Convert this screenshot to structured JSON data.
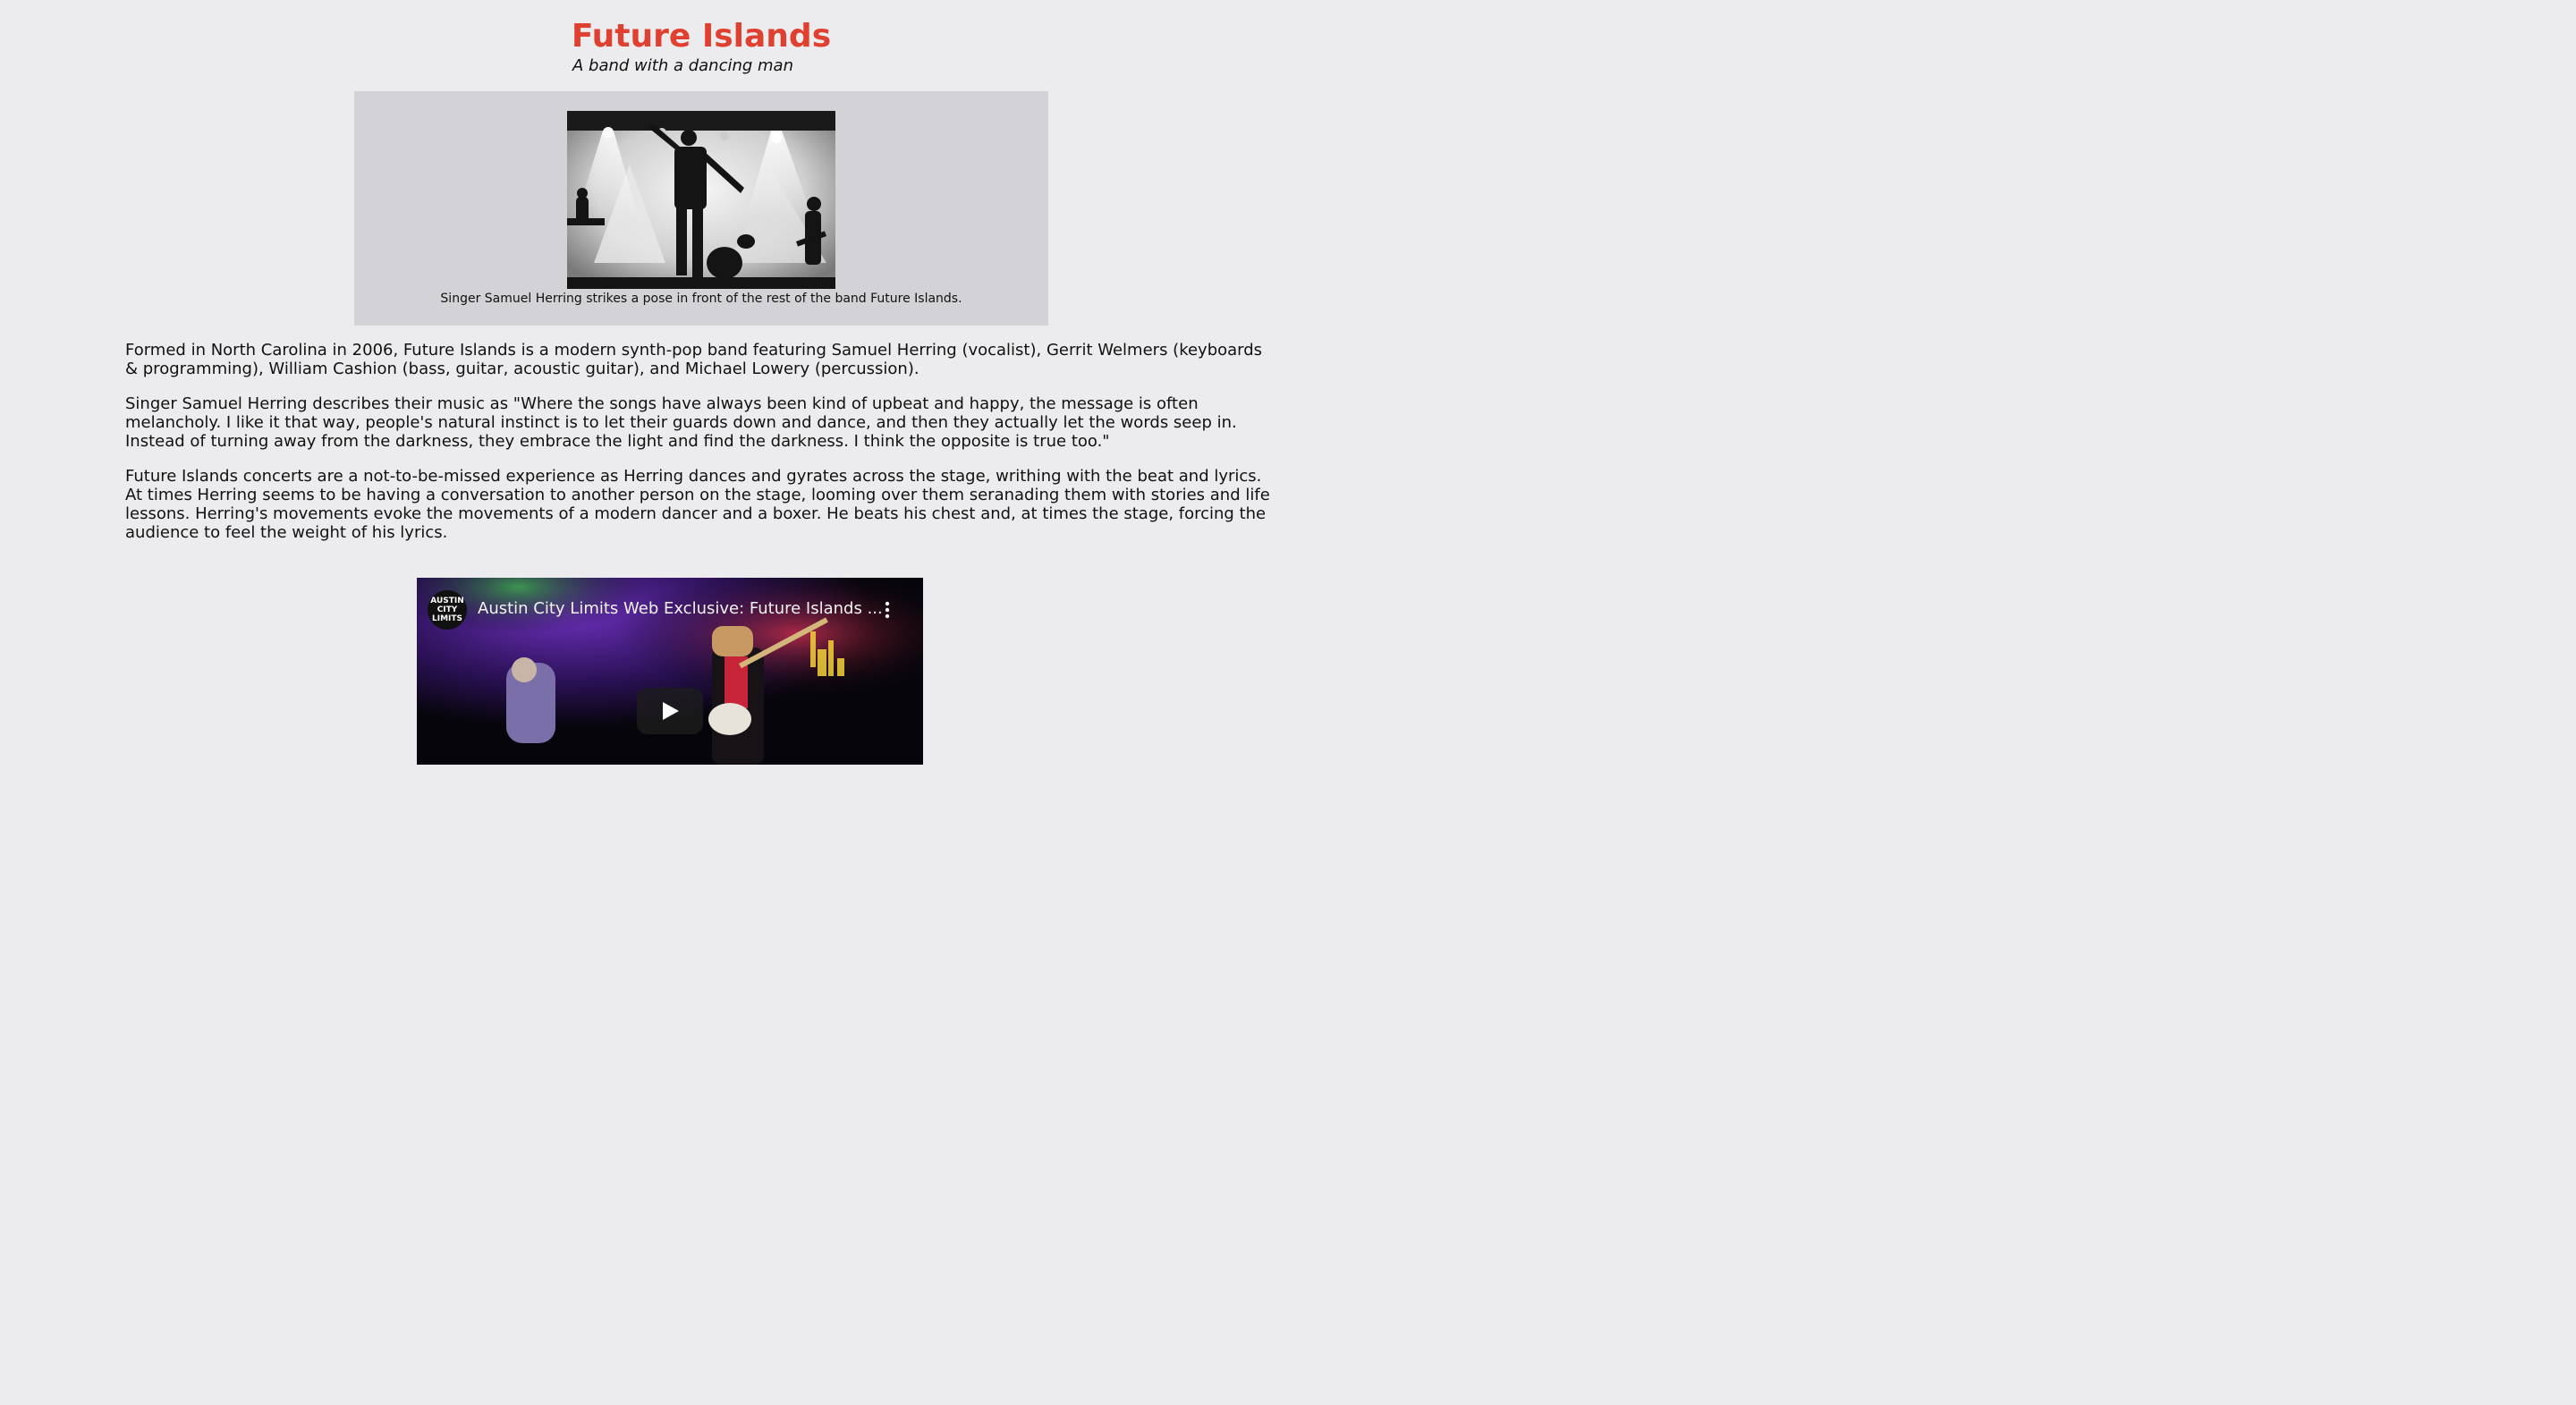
{
  "header": {
    "title": "Future Islands",
    "subtitle": "A band with a dancing man"
  },
  "figure": {
    "caption": "Singer Samuel Herring strikes a pose in front of the rest of the band Future Islands."
  },
  "article": {
    "paragraphs": [
      "Formed in North Carolina in 2006, Future Islands is a modern synth-pop band featuring Samuel Herring (vocalist), Gerrit Welmers (keyboards & programming), William Cashion (bass, guitar, acoustic guitar), and Michael Lowery (percussion).",
      "Singer Samuel Herring describes their music as \"Where the songs have always been kind of upbeat and happy, the message is often melancholy. I like it that way, people's natural instinct is to let their guards down and dance, and then they actually let the words seep in. Instead of turning away from the darkness, they embrace the light and find the darkness. I think the opposite is true too.\"",
      "Future Islands concerts are a not-to-be-missed experience as Herring dances and gyrates across the stage, writhing with the beat and lyrics. At times Herring seems to be having a conversation to another person on the stage, looming over them seranading them with stories and life lessons. Herring's movements evoke the movements of a modern dancer and a boxer. He beats his chest and, at times the stage, forcing the audience to feel the weight of his lyrics."
    ]
  },
  "video": {
    "title": "Austin City Limits Web Exclusive: Future Islands ...",
    "channel_logo_text": "AUSTIN CITY LIMITS",
    "icons": {
      "menu": "more-vert-icon",
      "play": "play-icon"
    }
  },
  "colors": {
    "background": "#ececee",
    "title": "#e0402f",
    "figure_box": "#d3d2d6"
  }
}
